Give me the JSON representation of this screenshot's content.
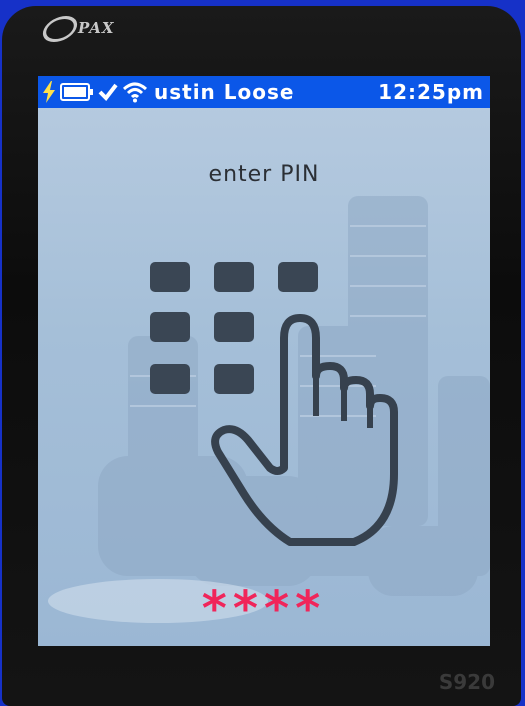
{
  "device": {
    "brand": "PAX",
    "model": "S920"
  },
  "statusbar": {
    "icons": [
      "charging-bolt-icon",
      "battery-icon",
      "checkmark-icon",
      "wifi-icon"
    ],
    "merchant_name": "ustin Loose",
    "time": "12:25pm",
    "background_color": "#0b57e8"
  },
  "prompt": {
    "text": "enter PIN"
  },
  "pin_entry": {
    "masked_value": "****",
    "mask_color": "#f0255a"
  },
  "illustration": {
    "icon": "hand-pressing-keypad-icon"
  }
}
